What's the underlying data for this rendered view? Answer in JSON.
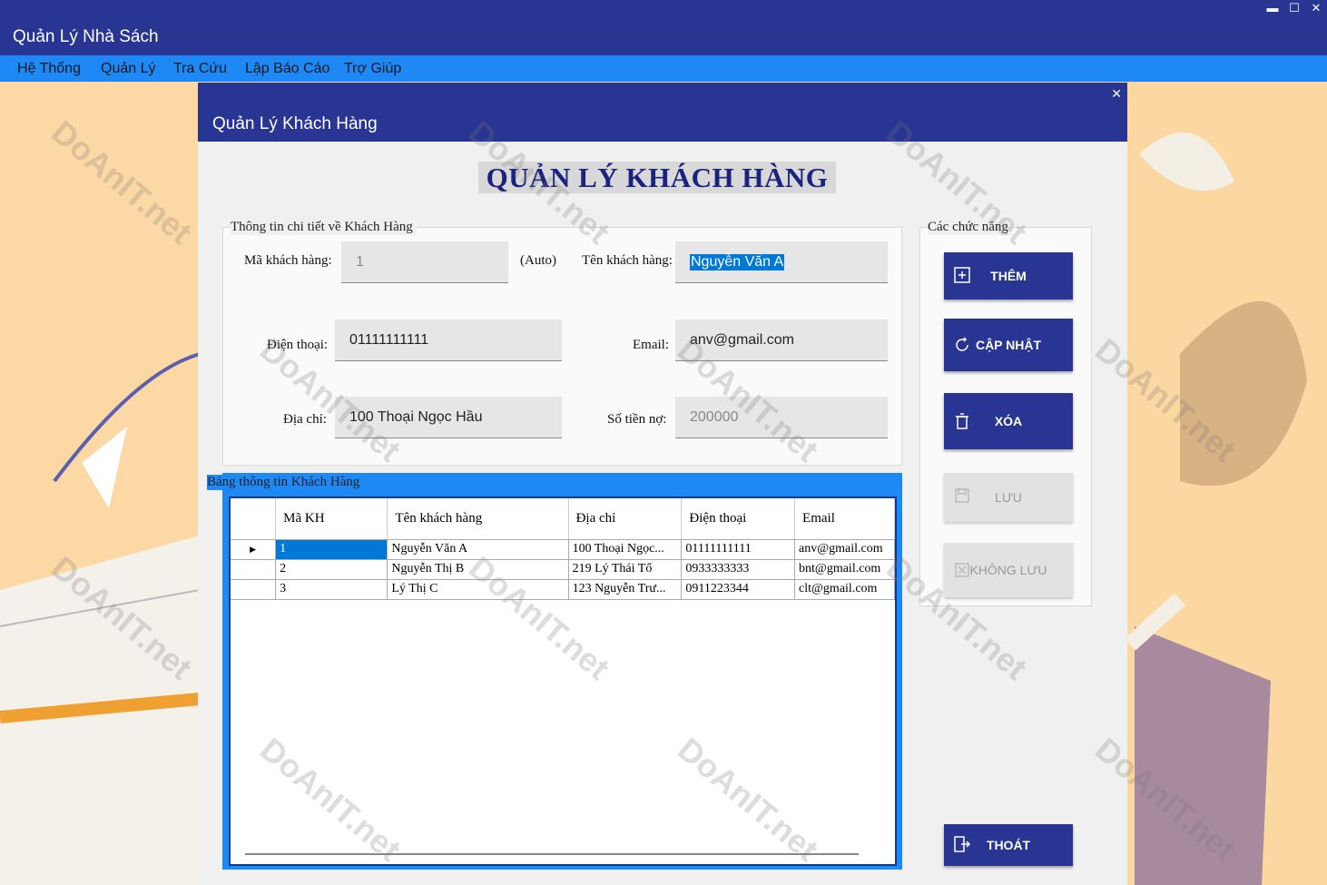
{
  "app": {
    "title": "Quản Lý Nhà Sách",
    "controls": {
      "minimize": "▬",
      "maximize": "☐",
      "close": "✕"
    }
  },
  "menu": [
    "Hệ Thống",
    "Quản Lý",
    "Tra Cứu",
    "Lập Báo Cáo",
    "Trợ Giúp"
  ],
  "child_window": {
    "title": "Quản Lý Khách Hàng",
    "close": "✕",
    "heading": "QUẢN LÝ KHÁCH HÀNG"
  },
  "details": {
    "group_title": "Thông tin chi tiết về Khách Hàng",
    "ma_kh_label": "Mã khách hàng:",
    "ma_kh_value": "1",
    "auto_label": "(Auto)",
    "ten_kh_label": "Tên khách hàng:",
    "ten_kh_value": "Nguyễn Văn A",
    "dien_thoai_label": "Điện thoại:",
    "dien_thoai_value": "01111111111",
    "email_label": "Email:",
    "email_value": "anv@gmail.com",
    "dia_chi_label": "Địa chỉ:",
    "dia_chi_value": "100 Thoại Ngọc Hầu",
    "so_tien_no_label": "Số tiền nợ:",
    "so_tien_no_value": "200000"
  },
  "grid": {
    "group_title": "Bảng thông tin Khách Hàng",
    "columns": [
      "Mã KH",
      "Tên khách hàng",
      "Địa chỉ",
      "Điện thoại",
      "Email"
    ],
    "rows": [
      [
        "1",
        "Nguyễn Văn A",
        "100 Thoại Ngọc...",
        "01111111111",
        "anv@gmail.com"
      ],
      [
        "2",
        "Nguyễn Thị B",
        "219 Lý Thái Tổ",
        "0933333333",
        "bnt@gmail.com"
      ],
      [
        "3",
        "Lý Thị C",
        "123 Nguyễn Trư...",
        "0911223344",
        "clt@gmail.com"
      ]
    ],
    "current_row_marker": "▶"
  },
  "functions": {
    "group_title": "Các chức năng",
    "them": "THÊM",
    "cap_nhat": "CẬP NHẬT",
    "xoa": "XÓA",
    "luu": "LƯU",
    "khong_luu": "KHÔNG LƯU",
    "thoat": "THOÁT"
  },
  "colors": {
    "title_bar": "#283593",
    "menu_bar": "#1e88f5",
    "selection": "#0078d7",
    "background": "#fcd9a6"
  },
  "watermark": "DoAnIT.net"
}
